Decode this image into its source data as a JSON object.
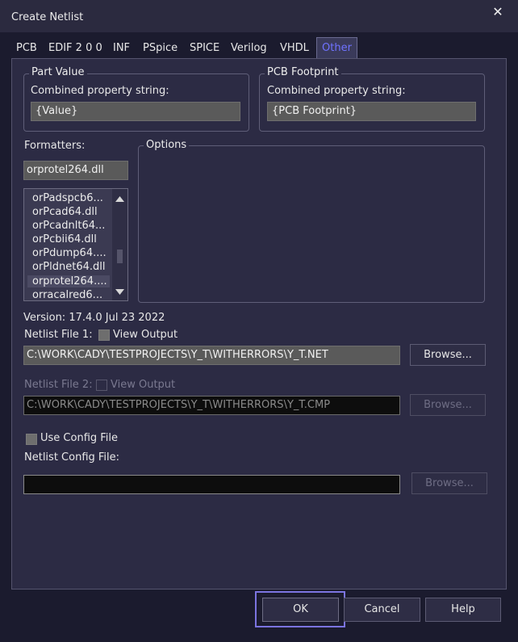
{
  "window": {
    "title": "Create Netlist",
    "close_glyph": "✕"
  },
  "tabs": [
    "PCB",
    "EDIF 2 0 0",
    "INF",
    "PSpice",
    "SPICE",
    "Verilog",
    "VHDL",
    "Other"
  ],
  "active_tab": "Other",
  "part_value": {
    "legend": "Part Value",
    "label": "Combined property string:",
    "value": "{Value}"
  },
  "pcb_footprint": {
    "legend": "PCB Footprint",
    "label": "Combined property string:",
    "value": "{PCB Footprint}"
  },
  "formatters": {
    "label": "Formatters:",
    "selected": "orprotel264.dll",
    "items": [
      "orPadspcb6...",
      "orPcad64.dll",
      "orPcadnlt64...",
      "orPcbii64.dll",
      "orPdump64....",
      "orPldnet64.dll",
      "orprotel264....",
      "orracalred6..."
    ]
  },
  "options": {
    "legend": "Options"
  },
  "version": "Version: 17.4.0  Jul 23 2022",
  "netlist1": {
    "label": "Netlist File 1:",
    "view_output": "View Output",
    "path": "C:\\WORK\\CADY\\TESTPROJECTS\\Y_T\\WITHERRORS\\Y_T.NET",
    "browse": "Browse..."
  },
  "netlist2": {
    "label": "Netlist File 2:",
    "view_output": "View Output",
    "path": "C:\\WORK\\CADY\\TESTPROJECTS\\Y_T\\WITHERRORS\\Y_T.CMP",
    "browse": "Browse..."
  },
  "config": {
    "use_label": "Use Config File",
    "file_label": "Netlist Config File:",
    "path": "",
    "browse": "Browse..."
  },
  "footer": {
    "ok": "OK",
    "cancel": "Cancel",
    "help": "Help"
  },
  "colors": {
    "accent": "#7b74e0",
    "active_tab_text": "#6f72ff"
  }
}
